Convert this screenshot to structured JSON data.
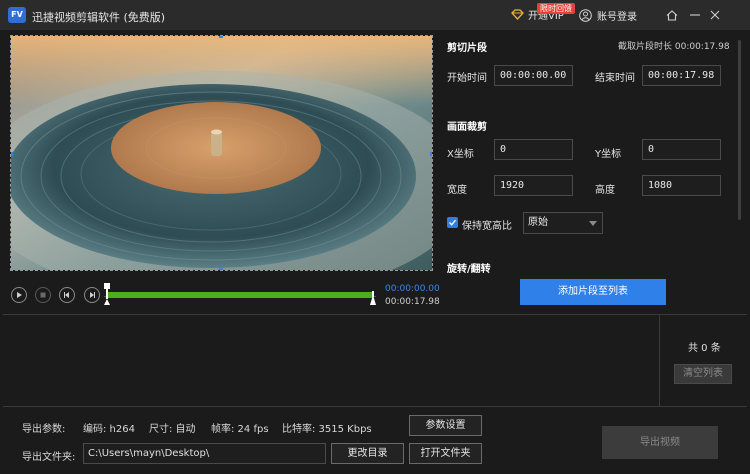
{
  "titlebar": {
    "logo_text": "FV",
    "title": "迅捷视频剪辑软件 (免费版)",
    "vip_label": "开通VIP",
    "vip_badge": "限时回馈",
    "login_label": "账号登录"
  },
  "player": {
    "current_time": "00:00:00.00",
    "total_time": "00:00:17.98"
  },
  "clip": {
    "section_title": "剪切片段",
    "duration_label": "截取片段时长 00:00:17.98",
    "start_label": "开始时间",
    "start_value": "00:00:00.00",
    "end_label": "结束时间",
    "end_value": "00:00:17.98"
  },
  "crop": {
    "section_title": "画面裁剪",
    "x_label": "X坐标",
    "x_value": "0",
    "y_label": "Y坐标",
    "y_value": "0",
    "width_label": "宽度",
    "width_value": "1920",
    "height_label": "高度",
    "height_value": "1080",
    "keep_ratio_label": "保持宽高比",
    "keep_ratio_checked": true,
    "ratio_selected": "原始"
  },
  "rotate": {
    "section_title": "旋转/翻转"
  },
  "add_button": "添加片段至列表",
  "list": {
    "count_label": "共 0 条",
    "clear_button": "清空列表"
  },
  "export": {
    "params_label": "导出参数:",
    "codec": "编码: h264",
    "size": "尺寸: 自动",
    "fps": "帧率: 24 fps",
    "bitrate": "比特率: 3515 Kbps",
    "settings_button": "参数设置",
    "folder_label": "导出文件夹:",
    "folder_path": "C:\\Users\\mayn\\Desktop\\",
    "change_dir_button": "更改目录",
    "open_folder_button": "打开文件夹",
    "export_button": "导出视频"
  },
  "colors": {
    "accent": "#2f80e8",
    "timeline": "#4caf1a",
    "badge": "#e5403a"
  }
}
